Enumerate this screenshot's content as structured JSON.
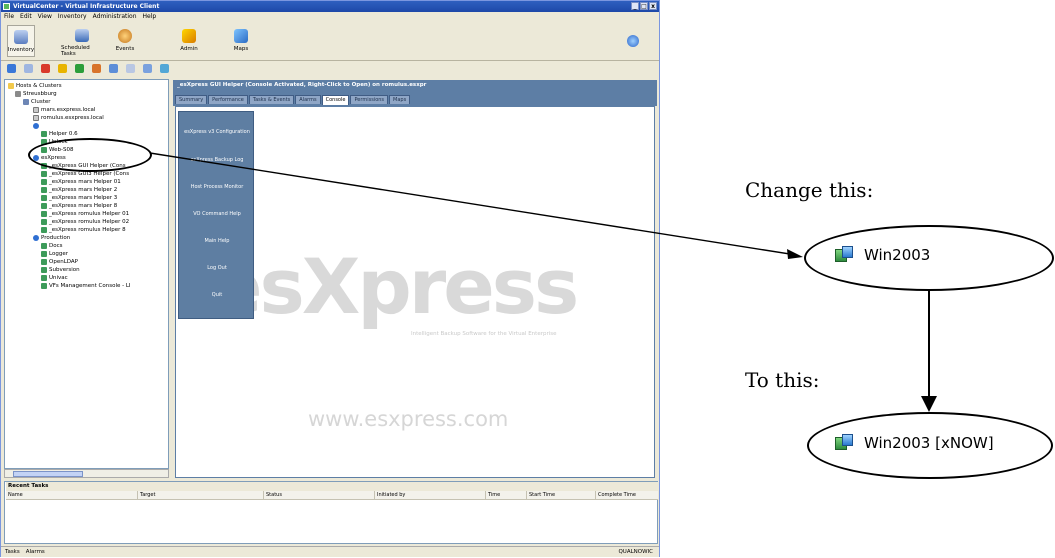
{
  "window": {
    "title": "VirtualCenter - Virtual Infrastructure Client"
  },
  "window_buttons": [
    "_",
    "□",
    "x"
  ],
  "menubar": [
    "File",
    "Edit",
    "View",
    "Inventory",
    "Administration",
    "Help"
  ],
  "toolbar": {
    "inventory": "Inventory",
    "scheduled_tasks": "Scheduled Tasks",
    "events": "Events",
    "admin": "Admin",
    "maps": "Maps"
  },
  "tree": {
    "root": "Hosts & Clusters",
    "datacenter": "Streusbburg",
    "cluster": "Cluster",
    "hosts": [
      "mars.esxpress.local",
      "romulus.esxpress.local"
    ],
    "pool1_children": [
      "Helper 0.6",
      "Unlock",
      "Web-S08"
    ],
    "pool2": "esXpress",
    "pool2_children": [
      "_esXpress GUI Helper  (Cons",
      "_esXpress GUI3 Helper  (Cons",
      "_esXpress mars Helper 01",
      "_esXpress mars Helper 2",
      "_esXpress mars Helper 3",
      "_esXpress mars Helper 8",
      "_esXpress romulus Helper 01",
      "_esXpress romulus Helper 02",
      "_esXpress romulus Helper 8"
    ],
    "pool3": "Production",
    "pool3_children": [
      "Docs",
      "Logger",
      "OpenLDAP",
      "Subversion",
      "Univac",
      "VFs Management Console - LI"
    ]
  },
  "vm_panel": {
    "title": "_esXpress GUI Helper  (Console Activated, Right-Click to Open) on romulus.esxpr",
    "tabs": [
      "Summary",
      "Performance",
      "Tasks & Events",
      "Alarms",
      "Console",
      "Permissions",
      "Maps"
    ],
    "active_tab": "Console"
  },
  "console_menu": [
    "esXpress v3 Configuration",
    "esXpress Backup Log",
    "Host Process Monitor",
    "VO Command Help",
    "Main Help",
    "Log Out",
    "Quit"
  ],
  "watermark": {
    "brand": "esXpress",
    "tagline": "Intelligent Backup Software for the Virtual Enterprise",
    "url": "www.esxpress.com"
  },
  "recent_tasks": {
    "title": "Recent Tasks",
    "columns": [
      "Name",
      "Target",
      "Status",
      "Initiated by",
      "Time",
      "Start Time",
      "Complete Time"
    ]
  },
  "statusbar": {
    "tasks": "Tasks",
    "alarms": "Alarms",
    "user": "QUALNOWIC"
  },
  "callout": {
    "change_label": "Change this:",
    "from_name": "Win2003",
    "to_label": "To this:",
    "to_name": "Win2003 [xNOW]"
  }
}
